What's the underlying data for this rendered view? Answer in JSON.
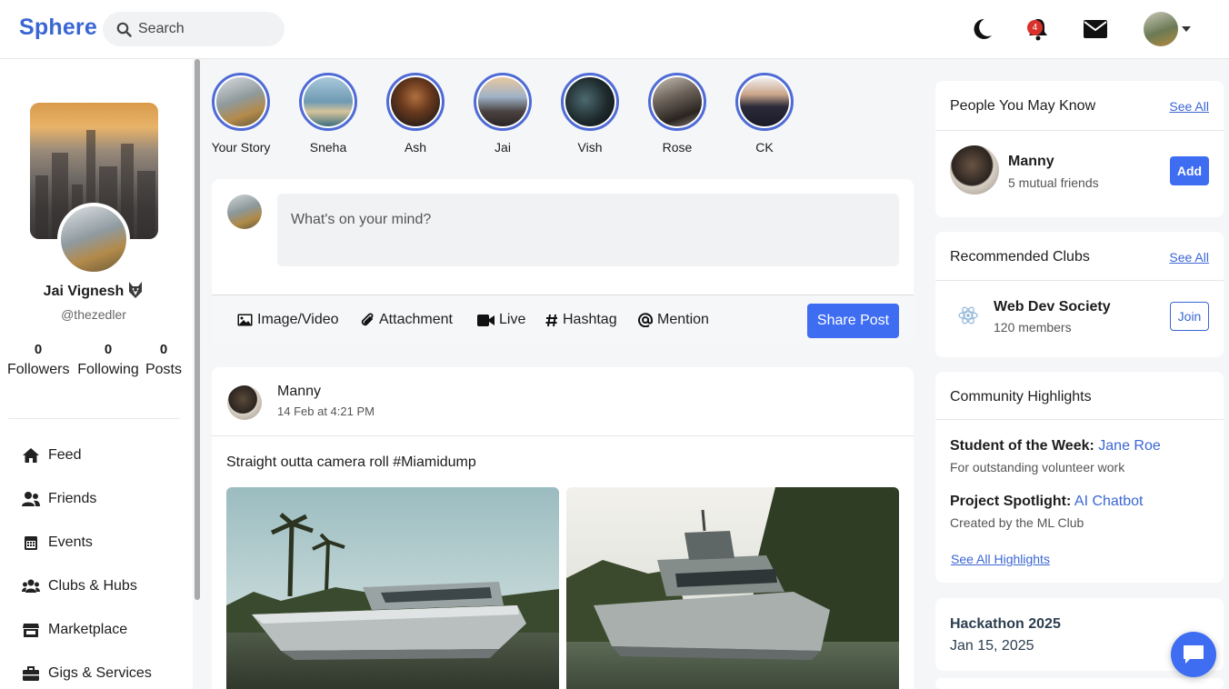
{
  "brand": "Sphere",
  "search": {
    "placeholder": "Search"
  },
  "header": {
    "notification_count": "4",
    "icons": [
      "moon-icon",
      "bell-icon",
      "envelope-icon",
      "avatar",
      "caret-down-icon"
    ]
  },
  "profile": {
    "name": "Jai Vignesh",
    "handle": "@thezedler",
    "stats": [
      {
        "value": "0",
        "label": "Followers"
      },
      {
        "value": "0",
        "label": "Following"
      },
      {
        "value": "0",
        "label": "Posts"
      }
    ]
  },
  "nav": [
    {
      "label": "Feed",
      "icon": "home-icon"
    },
    {
      "label": "Friends",
      "icon": "user-friends-icon"
    },
    {
      "label": "Events",
      "icon": "calendar-icon"
    },
    {
      "label": "Clubs & Hubs",
      "icon": "users-icon"
    },
    {
      "label": "Marketplace",
      "icon": "store-icon"
    },
    {
      "label": "Gigs & Services",
      "icon": "briefcase-icon"
    }
  ],
  "stories": [
    {
      "name": "Your Story"
    },
    {
      "name": "Sneha"
    },
    {
      "name": "Ash"
    },
    {
      "name": "Jai"
    },
    {
      "name": "Vish"
    },
    {
      "name": "Rose"
    },
    {
      "name": "CK"
    }
  ],
  "composer": {
    "placeholder": "What's on your mind?",
    "actions": [
      {
        "label": "Image/Video",
        "icon": "image-icon"
      },
      {
        "label": "Attachment",
        "icon": "paperclip-icon"
      },
      {
        "label": "Live",
        "icon": "video-icon"
      },
      {
        "label": "Hashtag",
        "icon": "hashtag-icon"
      },
      {
        "label": "Mention",
        "icon": "at-icon"
      }
    ],
    "share_label": "Share Post"
  },
  "post": {
    "author": "Manny",
    "time": "14 Feb at 4:21 PM",
    "text": "Straight outta camera roll #Miamidump"
  },
  "people": {
    "title": "People You May Know",
    "see_all": "See All",
    "person_name": "Manny",
    "mutual": "5 mutual friends",
    "add_label": "Add"
  },
  "clubs": {
    "title": "Recommended Clubs",
    "see_all": "See All",
    "club_name": "Web Dev Society",
    "members": "120 members",
    "join_label": "Join"
  },
  "highlights": {
    "title": "Community Highlights",
    "items": [
      {
        "label": "Student of the Week:",
        "link": "Jane Roe",
        "desc": "For outstanding volunteer work"
      },
      {
        "label": "Project Spotlight:",
        "link": "AI Chatbot",
        "desc": "Created by the ML Club"
      }
    ],
    "see_all": "See All Highlights"
  },
  "event": {
    "title": "Hackathon 2025",
    "date": "Jan 15, 2025"
  },
  "colors": {
    "accent": "#3e6df2",
    "brand": "#3a66d4",
    "badge": "#d9322b",
    "story_ring": "#4f6bd6"
  }
}
